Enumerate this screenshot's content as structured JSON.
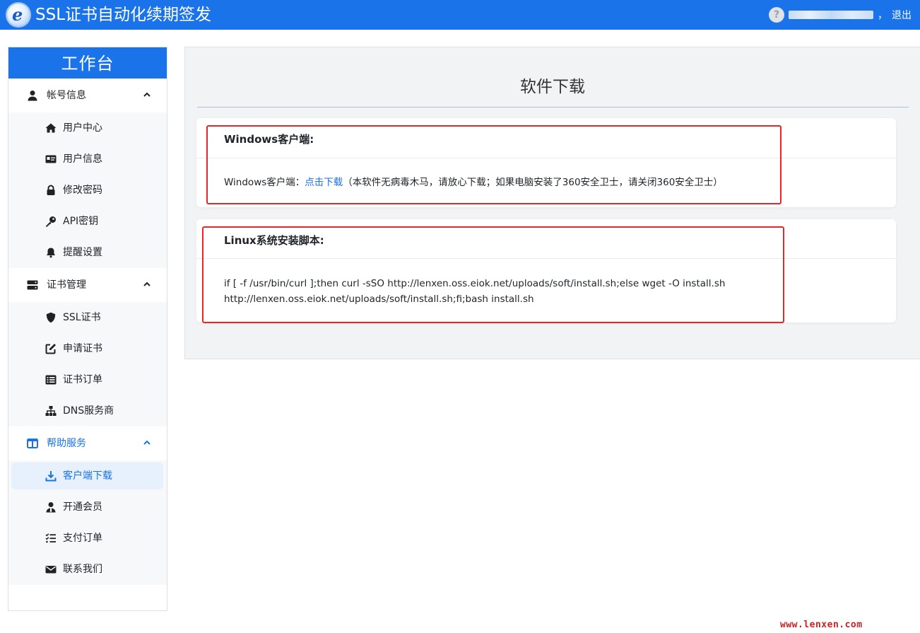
{
  "app": {
    "title": "SSL证书自动化续期签发",
    "logo_letter": "e"
  },
  "user": {
    "separator": "，",
    "logout_label": "退出"
  },
  "sidebar": {
    "title": "工作台",
    "groups": [
      {
        "label": "帐号信息",
        "icon": "user-icon",
        "items": [
          {
            "label": "用户中心",
            "icon": "home-icon"
          },
          {
            "label": "用户信息",
            "icon": "id-card-icon"
          },
          {
            "label": "修改密码",
            "icon": "lock-icon"
          },
          {
            "label": "API密钥",
            "icon": "key-icon"
          },
          {
            "label": "提醒设置",
            "icon": "bell-icon"
          }
        ]
      },
      {
        "label": "证书管理",
        "icon": "server-icon",
        "items": [
          {
            "label": "SSL证书",
            "icon": "shield-icon"
          },
          {
            "label": "申请证书",
            "icon": "edit-icon"
          },
          {
            "label": "证书订单",
            "icon": "list-icon"
          },
          {
            "label": "DNS服务商",
            "icon": "sitemap-icon"
          }
        ]
      },
      {
        "label": "帮助服务",
        "icon": "columns-icon",
        "items": [
          {
            "label": "客户端下载",
            "icon": "download-icon"
          },
          {
            "label": "开通会员",
            "icon": "user-tie-icon"
          },
          {
            "label": "支付订单",
            "icon": "checklist-icon"
          },
          {
            "label": "联系我们",
            "icon": "envelope-icon"
          }
        ]
      }
    ],
    "active_item": "客户端下载",
    "accent_color": "#1a73e8"
  },
  "main": {
    "title": "软件下载",
    "windows": {
      "heading": "Windows客户端:",
      "prefix": "Windows客户端：",
      "link_label": "点击下载",
      "note": "（本软件无病毒木马，请放心下载；如果电脑安装了360安全卫士，请关闭360安全卫士）"
    },
    "linux": {
      "heading": "Linux系统安装脚本:",
      "line1": "if [ -f /usr/bin/curl ];then curl -sSO http://lenxen.oss.eiok.net/uploads/soft/install.sh;else wget -O install.sh",
      "line2": "http://lenxen.oss.eiok.net/uploads/soft/install.sh;fi;bash install.sh"
    },
    "highlight_color": "#e8262a"
  },
  "watermark": "www.lenxen.com"
}
